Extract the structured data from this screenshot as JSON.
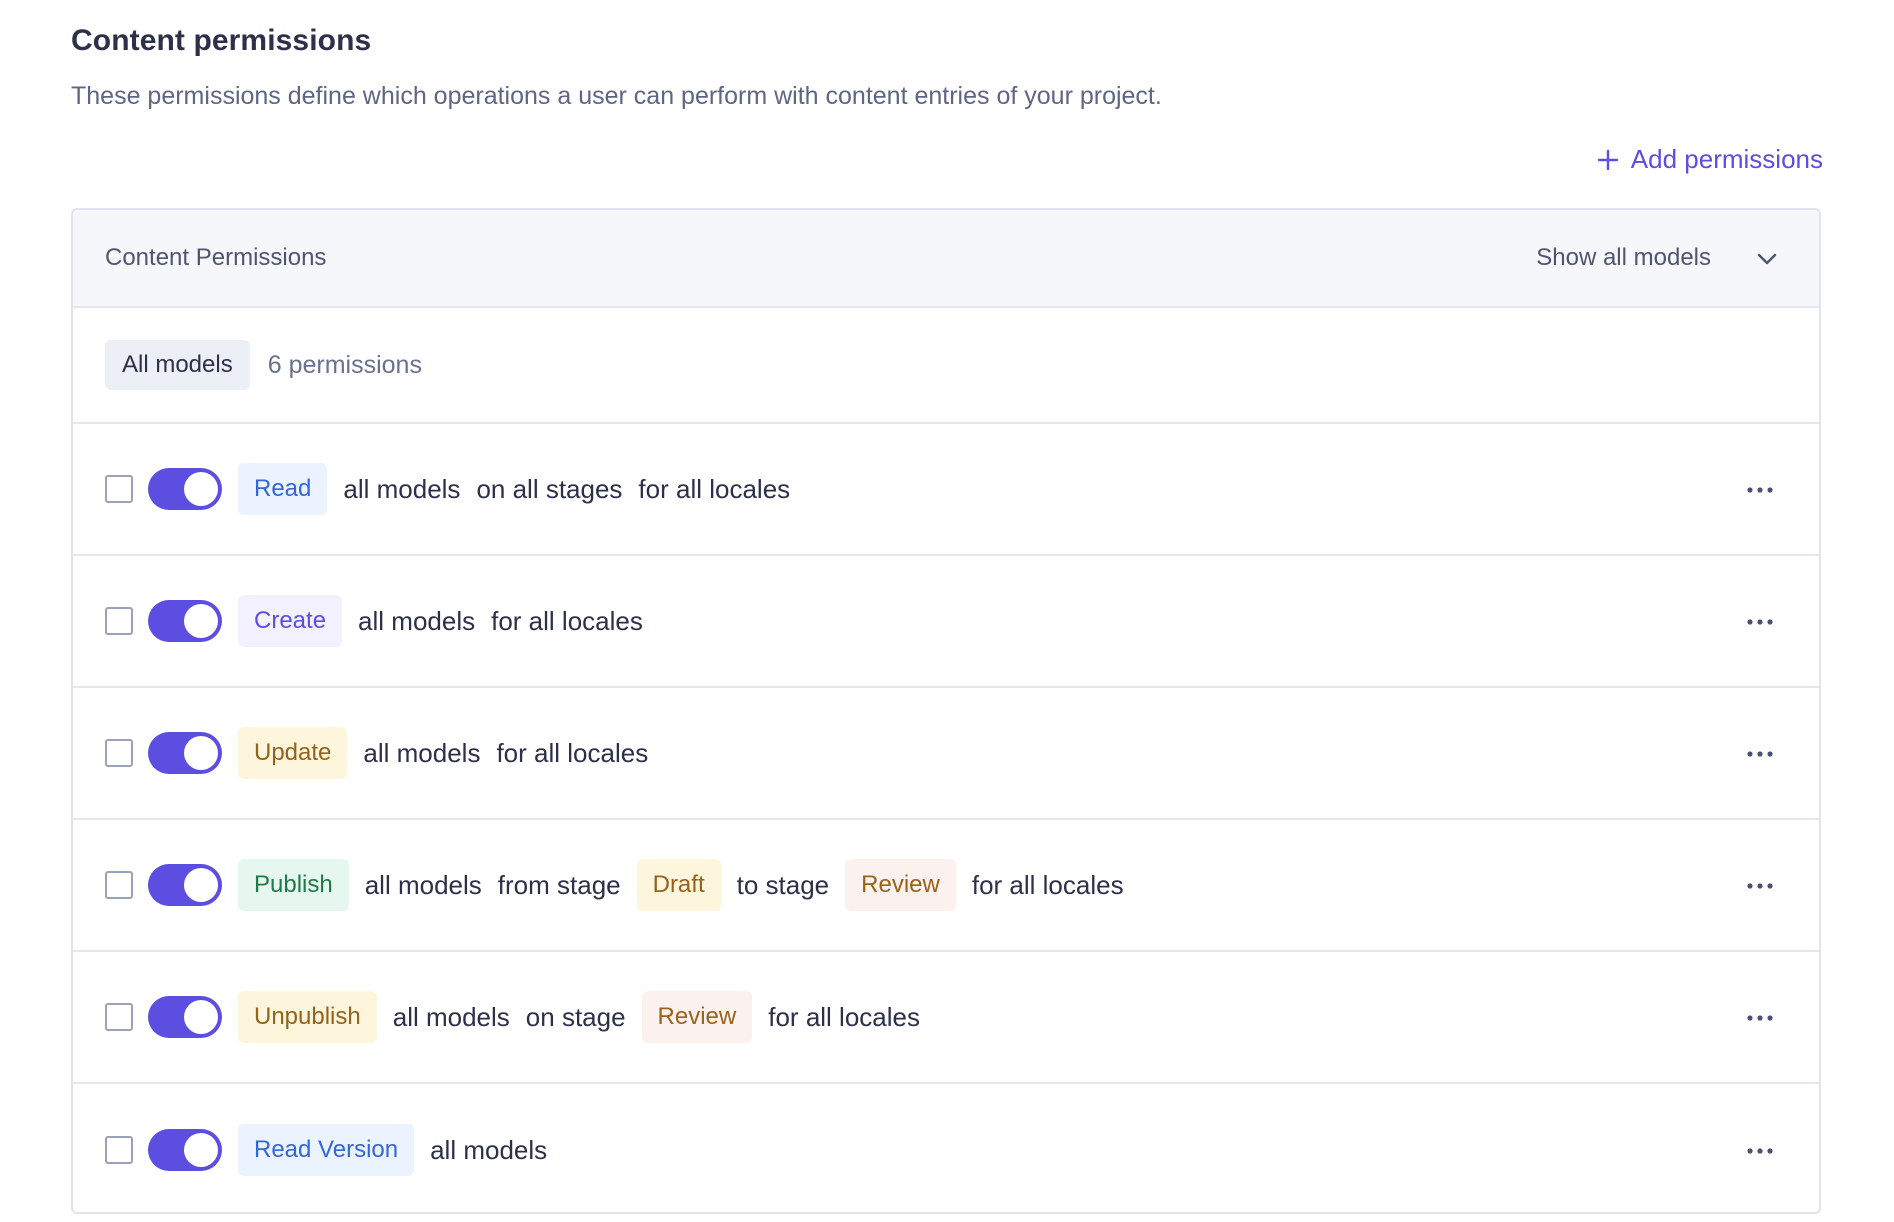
{
  "section": {
    "title": "Content permissions",
    "description": "These permissions define which operations a user can perform with content entries of your project.",
    "add_label": "Add permissions"
  },
  "panel": {
    "header_title": "Content Permissions",
    "filter_label": "Show all models"
  },
  "group": {
    "chip": "All models",
    "count": "6 permissions"
  },
  "rows": [
    {
      "action": "Read",
      "model": "all models",
      "stage_text": "on all stages",
      "locale_text": "for all locales",
      "enabled": true,
      "checked": false
    },
    {
      "action": "Create",
      "model": "all models",
      "locale_text": "for all locales",
      "enabled": true,
      "checked": false
    },
    {
      "action": "Update",
      "model": "all models",
      "locale_text": "for all locales",
      "enabled": true,
      "checked": false
    },
    {
      "action": "Publish",
      "model": "all models",
      "from_text": "from stage",
      "from_stage": "Draft",
      "to_text": "to stage",
      "to_stage": "Review",
      "locale_text": "for all locales",
      "enabled": true,
      "checked": false
    },
    {
      "action": "Unpublish",
      "model": "all models",
      "stage_text": "on stage",
      "stage": "Review",
      "locale_text": "for all locales",
      "enabled": true,
      "checked": false
    },
    {
      "action": "Read Version",
      "model": "all models",
      "enabled": true,
      "checked": false
    }
  ],
  "colors": {
    "accent": "#5b4ee0",
    "read_chip_bg": "#eaf3ff",
    "create_chip_bg": "#f3f0ff",
    "update_chip_bg": "#fdf6dc",
    "publish_chip_bg": "#e6f7ef",
    "stage_chip_bg": "#fbf1ef"
  },
  "icons": {
    "add": "plus-icon",
    "filter": "chevron-down-icon",
    "row_menu": "more-horizontal-icon"
  }
}
